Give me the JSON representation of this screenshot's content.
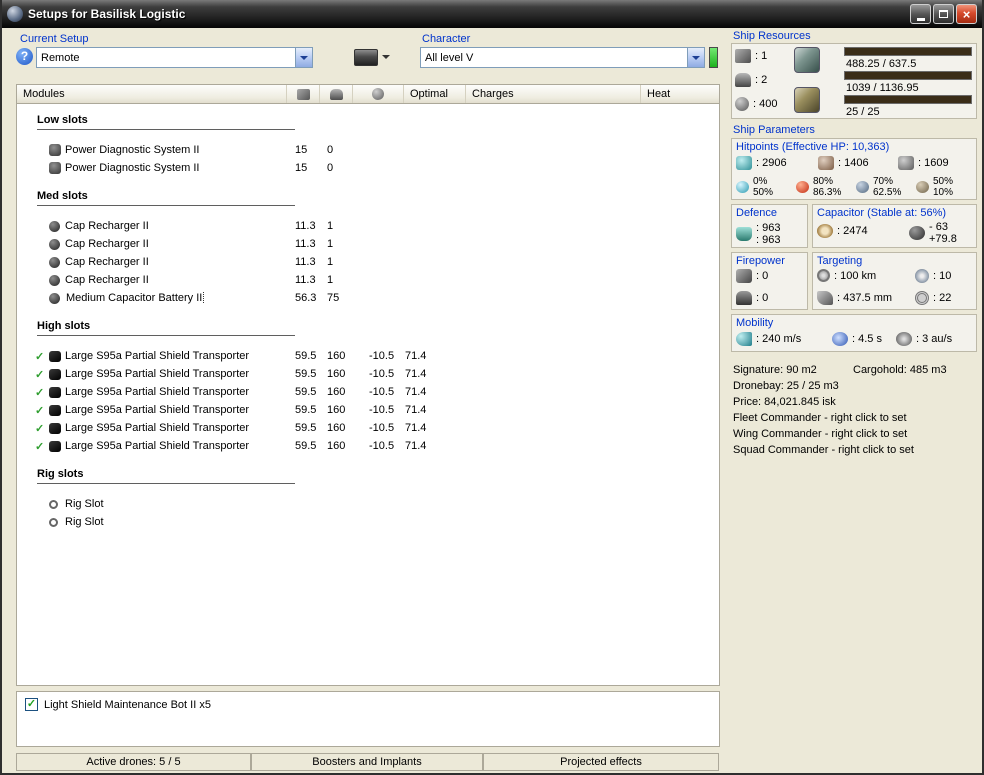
{
  "window": {
    "title": "Setups for Basilisk Logistic"
  },
  "icons": {
    "check": "✓",
    "help": "?",
    "close": "×"
  },
  "colors": {
    "label_blue": "#0033CC",
    "bar_orange": "#FF9500",
    "check_green": "#2F9E2F",
    "status_green": "#1DB21D",
    "close_red": "#D6492B"
  },
  "setup_bar": {
    "current_setup_label": "Current Setup",
    "setup_value": "Remote",
    "character_label": "Character",
    "character_value": "All level V"
  },
  "modules_header": {
    "modules": "Modules",
    "optimal": "Optimal",
    "charges": "Charges",
    "heat": "Heat"
  },
  "slots": {
    "low": {
      "title": "Low slots",
      "rows": [
        {
          "name": "Power Diagnostic System II",
          "v1": "15",
          "v2": "0"
        },
        {
          "name": "Power Diagnostic System II",
          "v1": "15",
          "v2": "0"
        }
      ]
    },
    "med": {
      "title": "Med slots",
      "rows": [
        {
          "name": "Cap Recharger II",
          "v1": "11.3",
          "v2": "1"
        },
        {
          "name": "Cap Recharger II",
          "v1": "11.3",
          "v2": "1"
        },
        {
          "name": "Cap Recharger II",
          "v1": "11.3",
          "v2": "1"
        },
        {
          "name": "Cap Recharger II",
          "v1": "11.3",
          "v2": "1"
        },
        {
          "name": "Medium Capacitor Battery II",
          "v1": "56.3",
          "v2": "75"
        }
      ]
    },
    "high": {
      "title": "High slots",
      "rows": [
        {
          "name": "Large S95a Partial Shield Transporter",
          "v1": "59.5",
          "v2": "160",
          "v3": "-10.5",
          "v4": "71.4"
        },
        {
          "name": "Large S95a Partial Shield Transporter",
          "v1": "59.5",
          "v2": "160",
          "v3": "-10.5",
          "v4": "71.4"
        },
        {
          "name": "Large S95a Partial Shield Transporter",
          "v1": "59.5",
          "v2": "160",
          "v3": "-10.5",
          "v4": "71.4"
        },
        {
          "name": "Large S95a Partial Shield Transporter",
          "v1": "59.5",
          "v2": "160",
          "v3": "-10.5",
          "v4": "71.4"
        },
        {
          "name": "Large S95a Partial Shield Transporter",
          "v1": "59.5",
          "v2": "160",
          "v3": "-10.5",
          "v4": "71.4"
        },
        {
          "name": "Large S95a Partial Shield Transporter",
          "v1": "59.5",
          "v2": "160",
          "v3": "-10.5",
          "v4": "71.4"
        }
      ]
    },
    "rig": {
      "title": "Rig slots",
      "rows": [
        {
          "name": "Rig Slot"
        },
        {
          "name": "Rig Slot"
        }
      ]
    }
  },
  "drone_bay": {
    "item": "Light Shield Maintenance Bot II x5"
  },
  "bottom_tabs": {
    "active_drones": "Active drones: 5 / 5",
    "boosters": "Boosters and Implants",
    "projected": "Projected effects"
  },
  "ship_resources": {
    "label": "Ship Resources",
    "turret_count": ": 1",
    "launcher_count": ": 2",
    "calibration_count": ": 400",
    "bars": [
      {
        "value": "488.25 / 637.5",
        "pct": 77
      },
      {
        "value": "1039 / 1136.95",
        "pct": 91
      },
      {
        "value": "25 / 25",
        "pct": 100
      }
    ]
  },
  "ship_parameters": {
    "label": "Ship Parameters",
    "hitpoints": {
      "label": "Hitpoints (Effective HP: 10,363)",
      "shield": ": 2906",
      "armor": ": 1406",
      "structure": ": 1609",
      "resists": [
        {
          "top": "0%",
          "bottom": "50%"
        },
        {
          "top": "80%",
          "bottom": "86.3%"
        },
        {
          "top": "70%",
          "bottom": "62.5%"
        },
        {
          "top": "50%",
          "bottom": "10%"
        }
      ]
    },
    "defence": {
      "label": "Defence",
      "value1": ": 963",
      "value2": ": 963"
    },
    "capacitor": {
      "label": "Capacitor (Stable at: 56%)",
      "capacity": ": 2474",
      "drain": "- 63",
      "recharge": "+79.8"
    },
    "firepower": {
      "label": "Firepower",
      "turret_dps": ": 0",
      "missile_dps": ": 0"
    },
    "targeting": {
      "label": "Targeting",
      "range": ": 100 km",
      "max_targets": ": 10",
      "scan_resolution": ": 437.5 mm",
      "sensor_strength": ": 22"
    },
    "mobility": {
      "label": "Mobility",
      "speed": ": 240 m/s",
      "align_time": ": 4.5 s",
      "warp_speed": ": 3 au/s"
    },
    "info": {
      "signature": "Signature: 90 m2",
      "cargohold": "Cargohold: 485 m3",
      "dronebay": "Dronebay: 25 / 25 m3",
      "price": "Price: 84,021.845 isk",
      "fleet_commander": "Fleet Commander - right click to set",
      "wing_commander": "Wing Commander - right click to set",
      "squad_commander": "Squad Commander - right click to set"
    }
  }
}
